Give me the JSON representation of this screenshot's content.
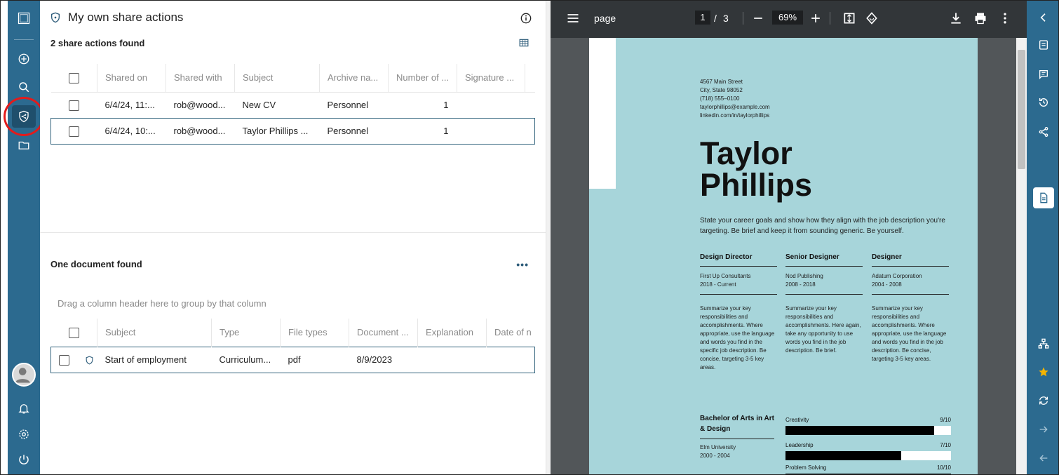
{
  "panel": {
    "title": "My own share actions",
    "count_label": "2 share actions found"
  },
  "shares_table": {
    "columns": [
      "Shared on",
      "Shared with",
      "Subject",
      "Archive na...",
      "Number of ...",
      "Signature ..."
    ],
    "rows": [
      {
        "shared_on": "6/4/24, 11:...",
        "shared_with": "rob@wood...",
        "subject": "New CV",
        "archive": "Personnel",
        "number": "1",
        "signature": ""
      },
      {
        "shared_on": "6/4/24, 10:...",
        "shared_with": "rob@wood...",
        "subject": "Taylor Phillips ...",
        "archive": "Personnel",
        "number": "1",
        "signature": ""
      }
    ]
  },
  "documents": {
    "count_label": "One document found",
    "more_label": "•••",
    "group_hint": "Drag a column header here to group by that column",
    "columns": [
      "Subject",
      "Type",
      "File types",
      "Document ...",
      "Explanation",
      "Date of n"
    ],
    "rows": [
      {
        "subject": "Start of employment",
        "type": "Curriculum...",
        "file_types": "pdf",
        "document": "8/9/2023",
        "explanation": "",
        "date": ""
      }
    ]
  },
  "pdf_viewer": {
    "title": "page",
    "current_page": "1",
    "page_separator": "/",
    "total_pages": "3",
    "zoom": "69%",
    "colors": {
      "toolbar": "#323639",
      "page_bg": "#a7d5da"
    }
  },
  "resume": {
    "address_lines": [
      "4567 Main Street",
      "City, State 98052",
      "(718) 555–0100",
      "taylorphillips@example.com",
      "linkedin.com/in/taylorphillips"
    ],
    "name_line1": "Taylor",
    "name_line2": "Phillips",
    "objective": "State your career goals and show how they align with the job description you're targeting. Be brief and keep it from sounding generic. Be yourself.",
    "jobs": [
      {
        "title": "Design Director",
        "company": "First Up Consultants",
        "years": "2018 - Current",
        "desc": "Summarize your key responsibilities and accomplishments. Where appropriate, use the language and words you find in the specific job description. Be concise, targeting 3-5 key areas."
      },
      {
        "title": "Senior Designer",
        "company": "Nod Publishing",
        "years": "2008 - 2018",
        "desc": "Summarize your key responsibilities and accomplishments. Here again, take any opportunity to use words you find in the job description. Be brief."
      },
      {
        "title": "Designer",
        "company": "Adatum Corporation",
        "years": "2004 - 2008",
        "desc": "Summarize your key responsibilities and accomplishments. Where appropriate, use the language and words you find in the job description. Be concise, targeting 3-5 key areas."
      }
    ],
    "education": {
      "degree": "Bachelor of Arts in Art & Design",
      "school": "Elm University",
      "years": "2000 - 2004"
    },
    "skills": [
      {
        "name": "Creativity",
        "score": "9/10",
        "level": 0.9
      },
      {
        "name": "Leadership",
        "score": "7/10",
        "level": 0.7
      },
      {
        "name": "Problem Solving",
        "score": "10/10",
        "level": 1.0
      }
    ]
  },
  "colors": {
    "rail": "#2c6a8f",
    "highlight_ring": "#e31b1b",
    "selected_row_border": "#34657e"
  }
}
